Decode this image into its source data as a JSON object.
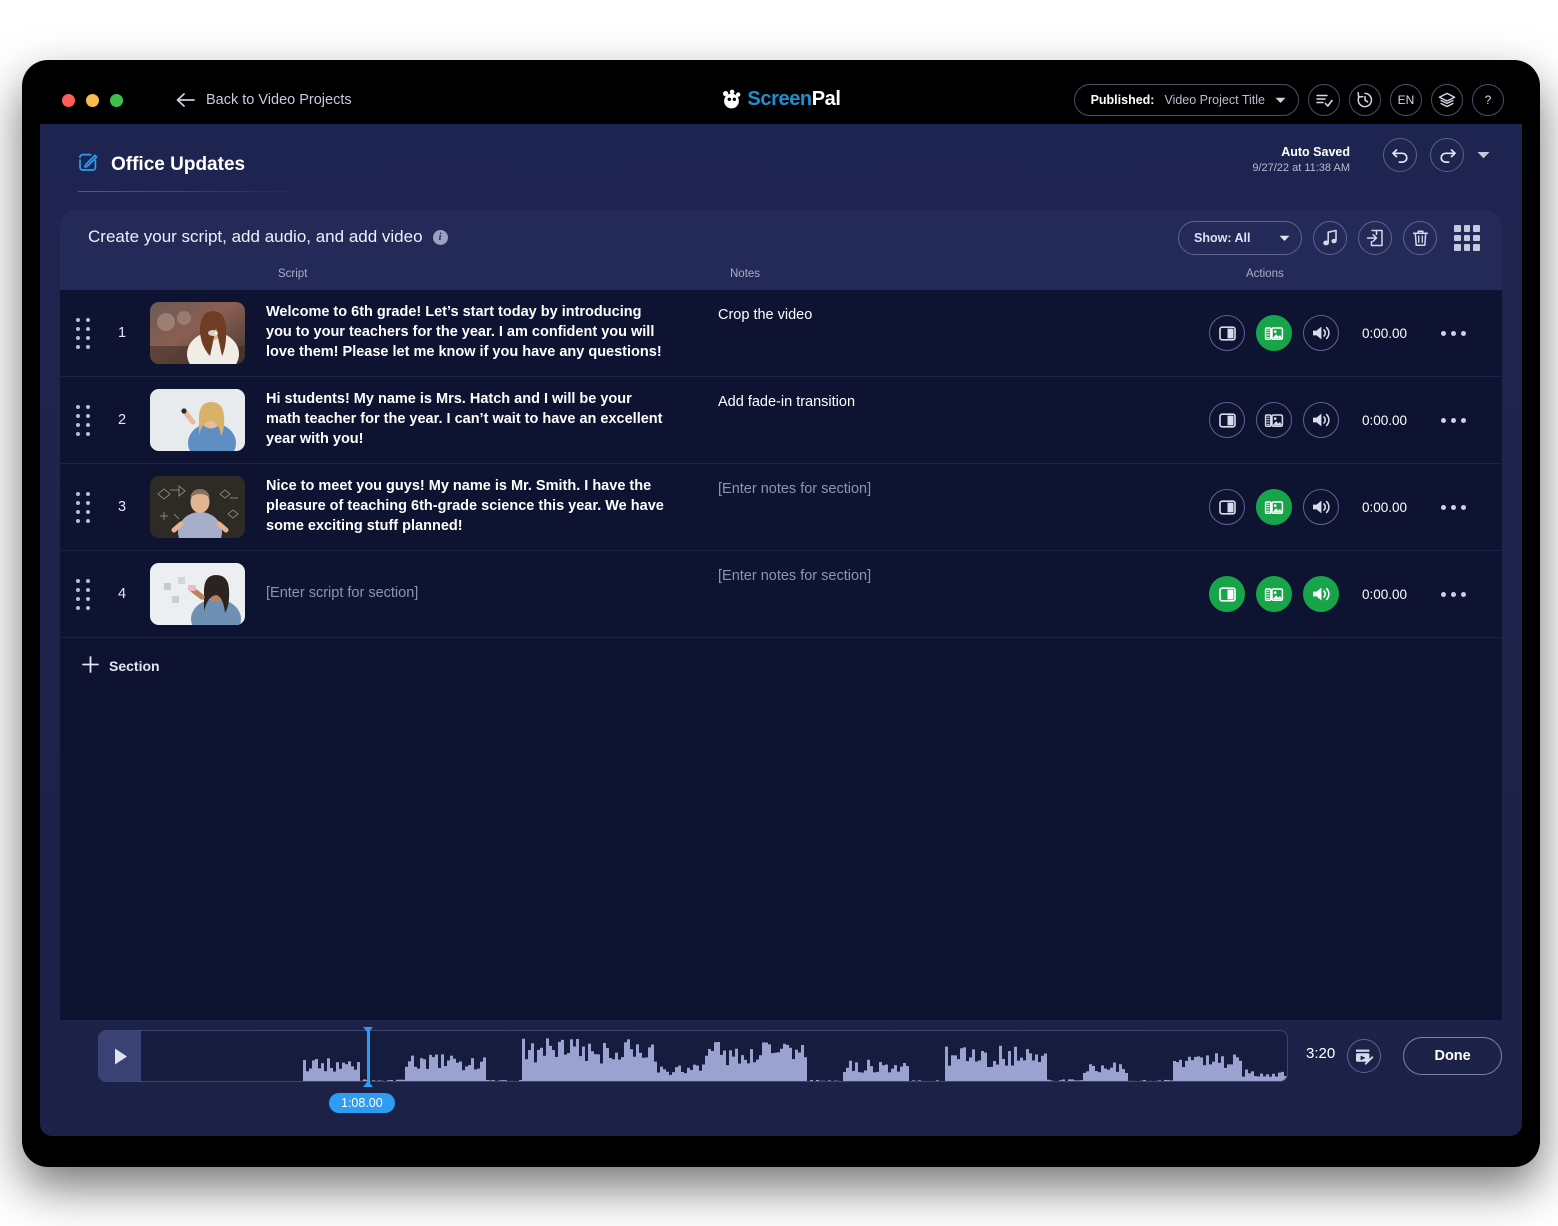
{
  "titlebar": {
    "back_label": "Back to Video Projects",
    "brand_part1": "Screen",
    "brand_part2": "Pal",
    "publish_label": "Published:",
    "publish_value": "Video Project Title",
    "lang_label": "EN",
    "help_label": "?",
    "icons": [
      "checklist-icon",
      "history-icon",
      "layers-icon",
      "help-icon"
    ]
  },
  "project": {
    "title": "Office Updates",
    "autosave_title": "Auto Saved",
    "autosave_time": "9/27/22 at 11:38 AM"
  },
  "panel": {
    "heading": "Create your script, add audio, and add video",
    "info_glyph": "i",
    "show_label": "Show: All",
    "columns": {
      "script": "Script",
      "notes": "Notes",
      "actions": "Actions"
    },
    "add_section_label": "Section"
  },
  "rows": [
    {
      "number": "1",
      "script": "Welcome to 6th grade! Let’s start today by introducing you to your teachers for the year. I am confident you will love them! Please let me know if you have any questions!",
      "script_is_placeholder": false,
      "notes": "Crop the video",
      "notes_is_placeholder": false,
      "time": "0:00.00",
      "actions": {
        "text_on": false,
        "media_on": true,
        "audio_on": false
      }
    },
    {
      "number": "2",
      "script": "Hi students! My name is Mrs. Hatch and I will be your math teacher for the year. I can’t wait to have an excellent year with you!",
      "script_is_placeholder": false,
      "notes": "Add fade-in transition",
      "notes_is_placeholder": false,
      "time": "0:00.00",
      "actions": {
        "text_on": false,
        "media_on": false,
        "audio_on": false
      }
    },
    {
      "number": "3",
      "script": "Nice to meet you guys! My name is Mr. Smith. I have the pleasure of teaching 6th-grade science this year. We have some exciting stuff planned!",
      "script_is_placeholder": false,
      "notes": "[Enter notes for section]",
      "notes_is_placeholder": true,
      "time": "0:00.00",
      "actions": {
        "text_on": false,
        "media_on": true,
        "audio_on": false
      }
    },
    {
      "number": "4",
      "script": "[Enter script for section]",
      "script_is_placeholder": true,
      "notes": "[Enter notes for section]",
      "notes_is_placeholder": true,
      "time": "0:00.00",
      "actions": {
        "text_on": true,
        "media_on": true,
        "audio_on": true
      }
    }
  ],
  "timeline": {
    "playhead_time": "1:08.00",
    "total_time": "3:20",
    "done_label": "Done"
  },
  "colors": {
    "accent_green": "#18a54a",
    "accent_blue": "#2f9cf4",
    "brand_blue": "#1d8fd1",
    "panel_bg": "#232a57",
    "rows_bg": "#0d1330"
  }
}
